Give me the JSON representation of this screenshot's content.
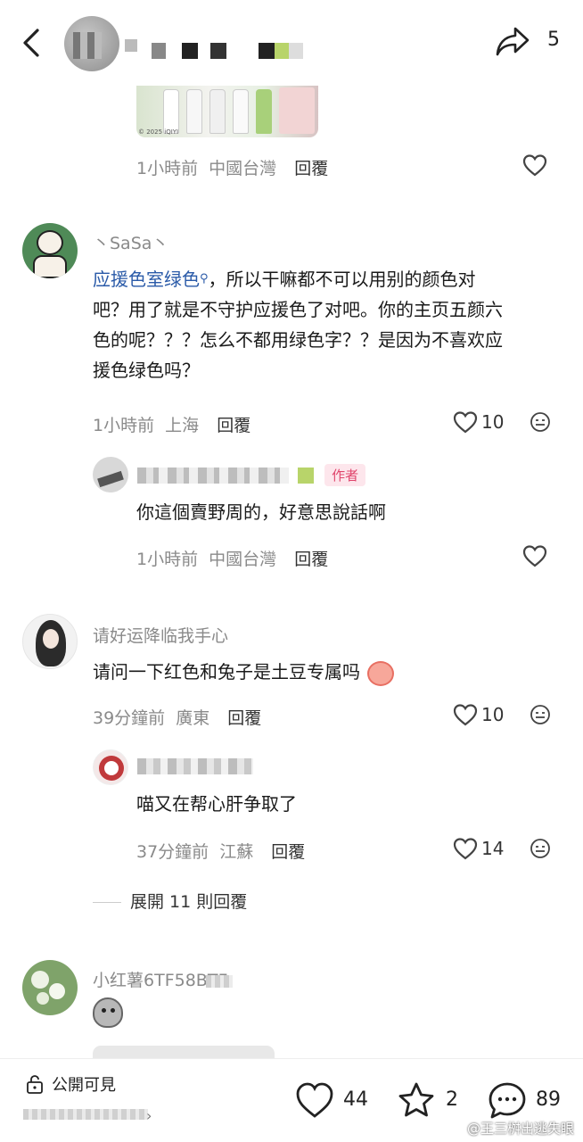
{
  "header": {
    "share_count": "5"
  },
  "comment0_reply": {
    "time": "1小時前",
    "location": "中國台灣",
    "reply_label": "回覆",
    "image_caption": "© 2025 iQIYI",
    "image_brand": "Purjoy"
  },
  "comment1": {
    "username": "丶SaSa丶",
    "text_highlight": "应援色室绿色",
    "text_line1_rest": "，所以干嘛都不可以用别的颜色对",
    "text_line2": "吧？用了就是不守护应援色了对吧。你的主页五颜六",
    "text_line3": "色的呢？？？怎么不都用绿色字？？是因为不喜欢应",
    "text_line4": "援色绿色吗？",
    "time": "1小時前",
    "location": "上海",
    "reply_label": "回覆",
    "likes": "10"
  },
  "comment1_reply": {
    "author_tag": "作者",
    "text": "你這個賣野周的，好意思說話啊",
    "time": "1小時前",
    "location": "中國台灣",
    "reply_label": "回覆"
  },
  "comment2": {
    "username": "请好运降临我手心",
    "text": "请问一下红色和兔子是土豆专属吗",
    "time": "39分鐘前",
    "location": "廣東",
    "reply_label": "回覆",
    "likes": "10"
  },
  "comment2_reply": {
    "text": "喵又在帮心肝争取了",
    "time": "37分鐘前",
    "location": "江蘇",
    "reply_label": "回覆",
    "likes": "14"
  },
  "expand_label": "展開 11 則回覆",
  "comment3": {
    "username": "小红薯6TF58BTF"
  },
  "bottom_bar": {
    "visibility": "公開可見",
    "likes": "44",
    "favorites": "2",
    "comments": "89"
  },
  "watermark": "@王三桝出逃失眼"
}
